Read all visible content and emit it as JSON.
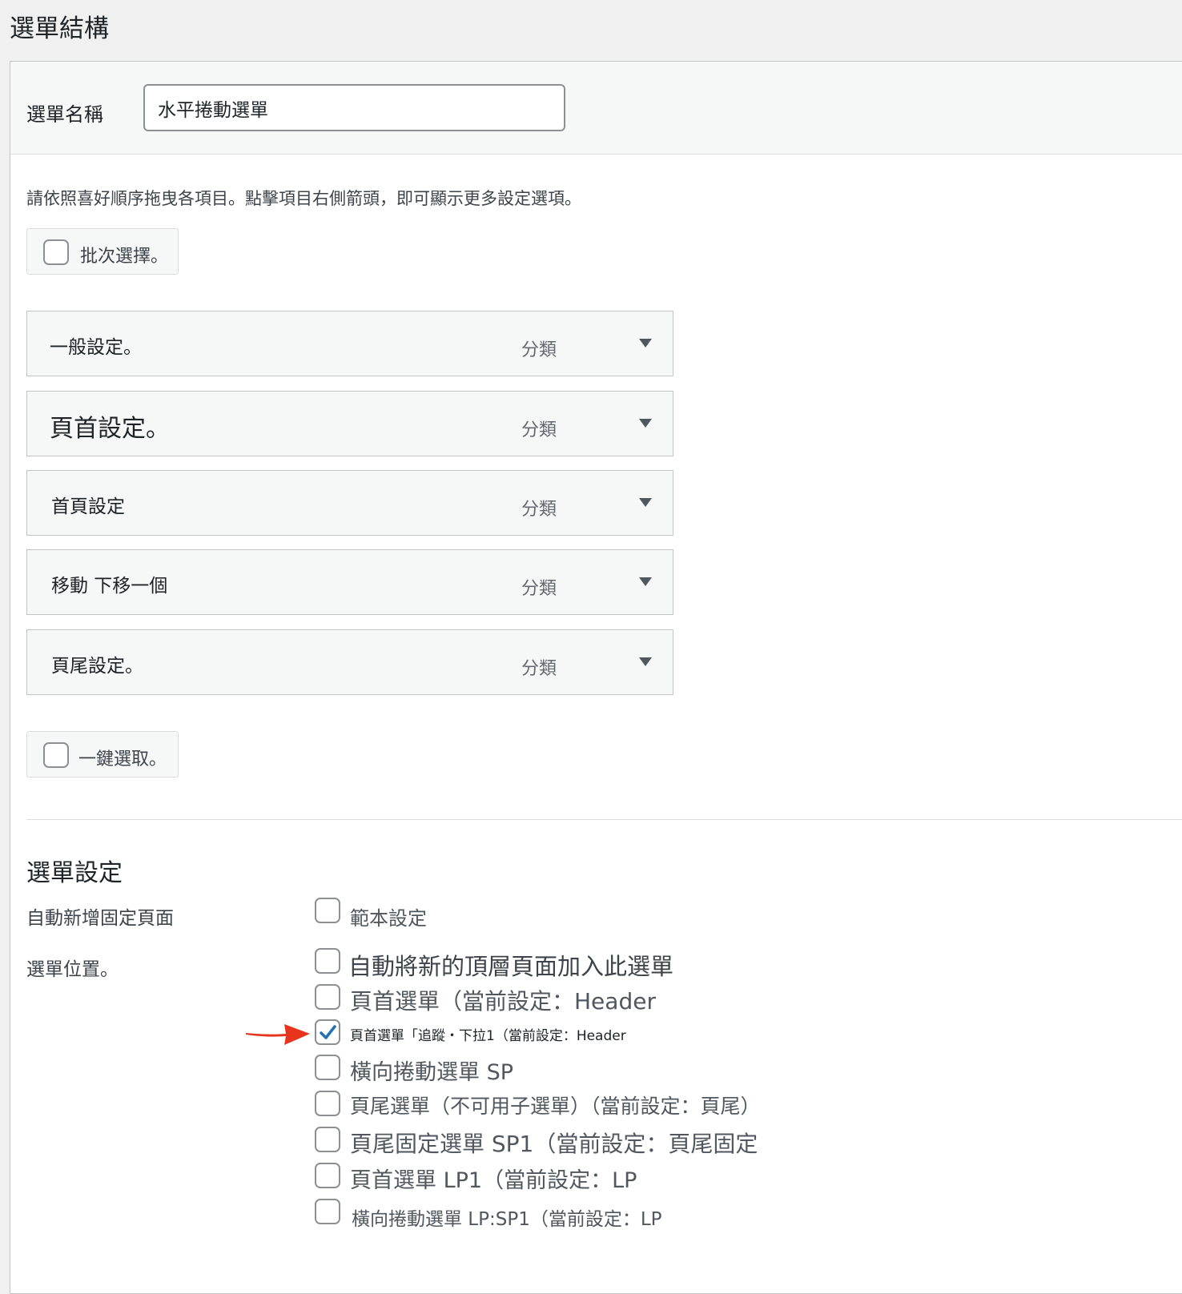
{
  "page": {
    "heading": "選單結構"
  },
  "menu_name": {
    "label": "選單名稱",
    "value": "水平捲動選單"
  },
  "instructions": "請依照喜好順序拖曳各項目。點擊項目右側箭頭，即可顯示更多設定選項。",
  "bulk_select": {
    "label": "批次選擇。",
    "checked": false
  },
  "menu_items": [
    {
      "title": "一般設定。",
      "type": "分類"
    },
    {
      "title": "頁首設定。",
      "type": "分類"
    },
    {
      "title": "首頁設定",
      "type": "分類"
    },
    {
      "title": "移動 下移一個",
      "type": "分類"
    },
    {
      "title": "頁尾設定。",
      "type": "分類"
    }
  ],
  "select_all": {
    "label": "一鍵選取。",
    "checked": false
  },
  "menu_settings": {
    "title": "選單設定",
    "auto_add_label": "自動新增固定頁面",
    "auto_add_option": "範本設定",
    "locations_label": "選單位置。",
    "locations": [
      {
        "label": "自動將新的頂層頁面加入此選單",
        "checked": false
      },
      {
        "label": "頁首選單（當前設定：Header",
        "checked": false
      },
      {
        "label": "頁首選單「追蹤・下拉1（當前設定：Header",
        "checked": true
      },
      {
        "label": "橫向捲動選單 SP",
        "checked": false
      },
      {
        "label": "頁尾選單（不可用子選單）（當前設定：頁尾）",
        "checked": false
      },
      {
        "label": "頁尾固定選單 SP1（當前設定：頁尾固定",
        "checked": false
      },
      {
        "label": "頁首選單 LP1（當前設定：LP",
        "checked": false
      },
      {
        "label": "橫向捲動選單 LP:SP1（當前設定：LP",
        "checked": false
      }
    ]
  },
  "colors": {
    "accent": "#2271b1",
    "annotation_arrow": "#e8341c"
  }
}
